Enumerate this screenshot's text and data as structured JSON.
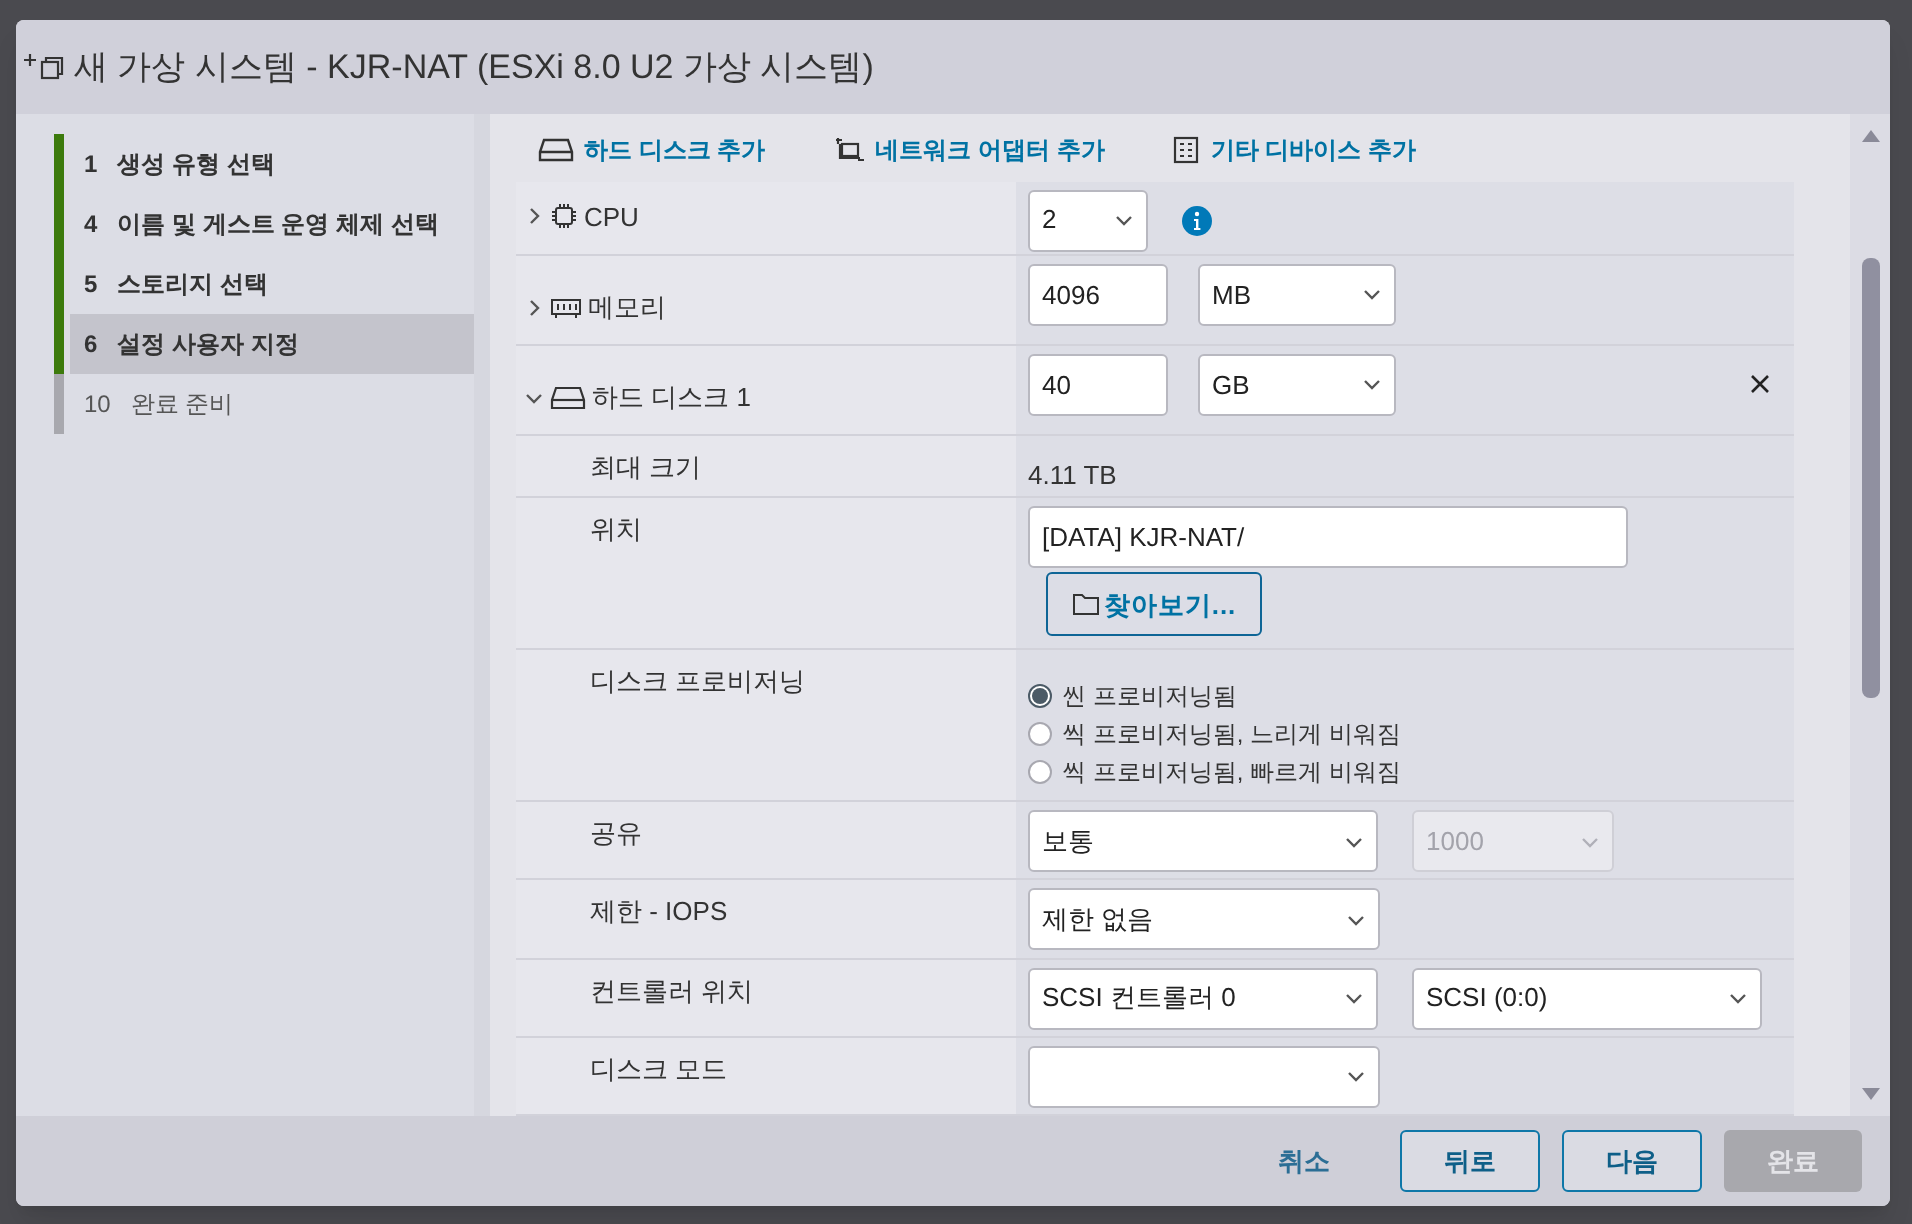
{
  "dialog": {
    "title": "새 가상 시스템 - KJR-NAT (ESXi 8.0 U2 가상 시스템)"
  },
  "steps": [
    {
      "number": "1",
      "label": "생성 유형 선택",
      "done": true,
      "selected": false
    },
    {
      "number": "4",
      "label": "이름 및 게스트 운영 체제 선택",
      "done": true,
      "selected": false
    },
    {
      "number": "5",
      "label": "스토리지 선택",
      "done": true,
      "selected": false
    },
    {
      "number": "6",
      "label": "설정 사용자 지정",
      "done": true,
      "selected": true
    },
    {
      "number": "10",
      "label": "완료 준비",
      "done": false,
      "selected": false
    }
  ],
  "toolbar": [
    {
      "label": "하드 디스크 추가",
      "kind": "disk"
    },
    {
      "label": "네트워크 어댑터 추가",
      "kind": "network"
    },
    {
      "label": "기타 디바이스 추가",
      "kind": "device"
    }
  ],
  "hardware": [
    {
      "kind": "select",
      "label": "CPU",
      "expanded": false,
      "value": "2",
      "info": true
    },
    {
      "kind": "size",
      "label": "메모리",
      "expanded": false,
      "value": "4096",
      "unit": "MB"
    },
    {
      "kind": "size",
      "label": "하드 디스크 1",
      "expanded": true,
      "value": "40",
      "unit": "GB",
      "removable": true,
      "children": [
        {
          "kind": "text",
          "label": "최대 크기",
          "value": "4.11 TB"
        },
        {
          "kind": "location",
          "label": "위치",
          "value": "[DATA] KJR-NAT/",
          "button": "찾아보기..."
        },
        {
          "kind": "radio",
          "label": "디스크 프로비저닝",
          "options": [
            {
              "label": "씬 프로비저닝됨",
              "selected": true
            },
            {
              "label": "씩 프로비저닝됨, 느리게 비워짐",
              "selected": false
            },
            {
              "label": "씩 프로비저닝됨, 빠르게 비워짐",
              "selected": false
            }
          ]
        },
        {
          "kind": "select",
          "label": "공유",
          "value": "보통",
          "second": {
            "value": "1000",
            "disabled": true
          }
        },
        {
          "kind": "select",
          "label": "제한 - IOPS",
          "value": "제한 없음"
        },
        {
          "kind": "select",
          "label": "컨트롤러 위치",
          "value": "SCSI 컨트롤러 0",
          "second": {
            "value": "SCSI (0:0)",
            "disabled": false
          }
        },
        {
          "kind": "select",
          "label": "디스크 모드"
        }
      ]
    }
  ],
  "footer": [
    {
      "label": "취소",
      "kind": "link"
    },
    {
      "label": "뒤로",
      "kind": "outline"
    },
    {
      "label": "다음",
      "kind": "outline"
    },
    {
      "label": "완료",
      "kind": "primary",
      "disabled": true
    }
  ]
}
